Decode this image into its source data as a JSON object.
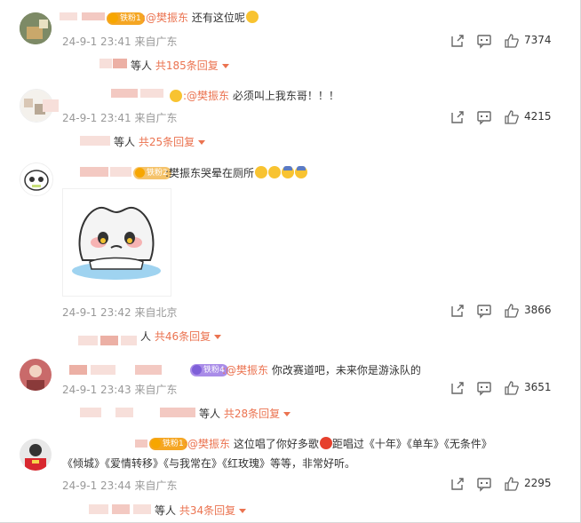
{
  "comments": [
    {
      "badge": "铁粉1",
      "mention": ":@樊振东",
      "text": " 还有这位呢",
      "timestamp": "24-9-1 23:41",
      "source": "来自广东",
      "likes": "7374",
      "replies": {
        "prefix": "等人",
        "total": "共185条回复"
      }
    },
    {
      "mention": ":@樊振东",
      "text": " 必须叫上我东哥！！！",
      "timestamp": "24-9-1 23:41",
      "source": "来自广东",
      "likes": "4215",
      "replies": {
        "prefix": "等人",
        "total": "共25条回复"
      }
    },
    {
      "badge": "铁粉2",
      "text": ":樊振东哭晕在厕所",
      "timestamp": "24-9-1 23:42",
      "source": "来自北京",
      "likes": "3866",
      "replies": {
        "prefix": "人",
        "total": "共46条回复"
      }
    },
    {
      "badge": "铁粉4",
      "mention": ":@樊振东",
      "text": " 你改赛道吧，未来你是游泳队的",
      "timestamp": "24-9-1 23:43",
      "source": "来自广东",
      "likes": "3651",
      "replies": {
        "prefix": "等人",
        "total": "共28条回复"
      }
    },
    {
      "badge": "铁粉1",
      "mention": ":@樊振东",
      "text": " 这位唱了你好多歌",
      "text_after_emoji": "距唱过《十年》《单车》《无条件》",
      "text_line2": "《倾城》《爱情转移》《与我常在》《红玫瑰》等等，非常好听。",
      "timestamp": "24-9-1 23:44",
      "source": "来自广东",
      "likes": "2295",
      "replies": {
        "prefix": "等人",
        "total": "共34条回复"
      }
    }
  ],
  "colors": {
    "mention": "#eb7350",
    "meta": "#999999",
    "badge_1": "#f5a623",
    "badge_4": "#a98ce8"
  },
  "icons": [
    "share-icon",
    "comment-icon",
    "like-icon",
    "emoji-icon",
    "sticker-image"
  ]
}
